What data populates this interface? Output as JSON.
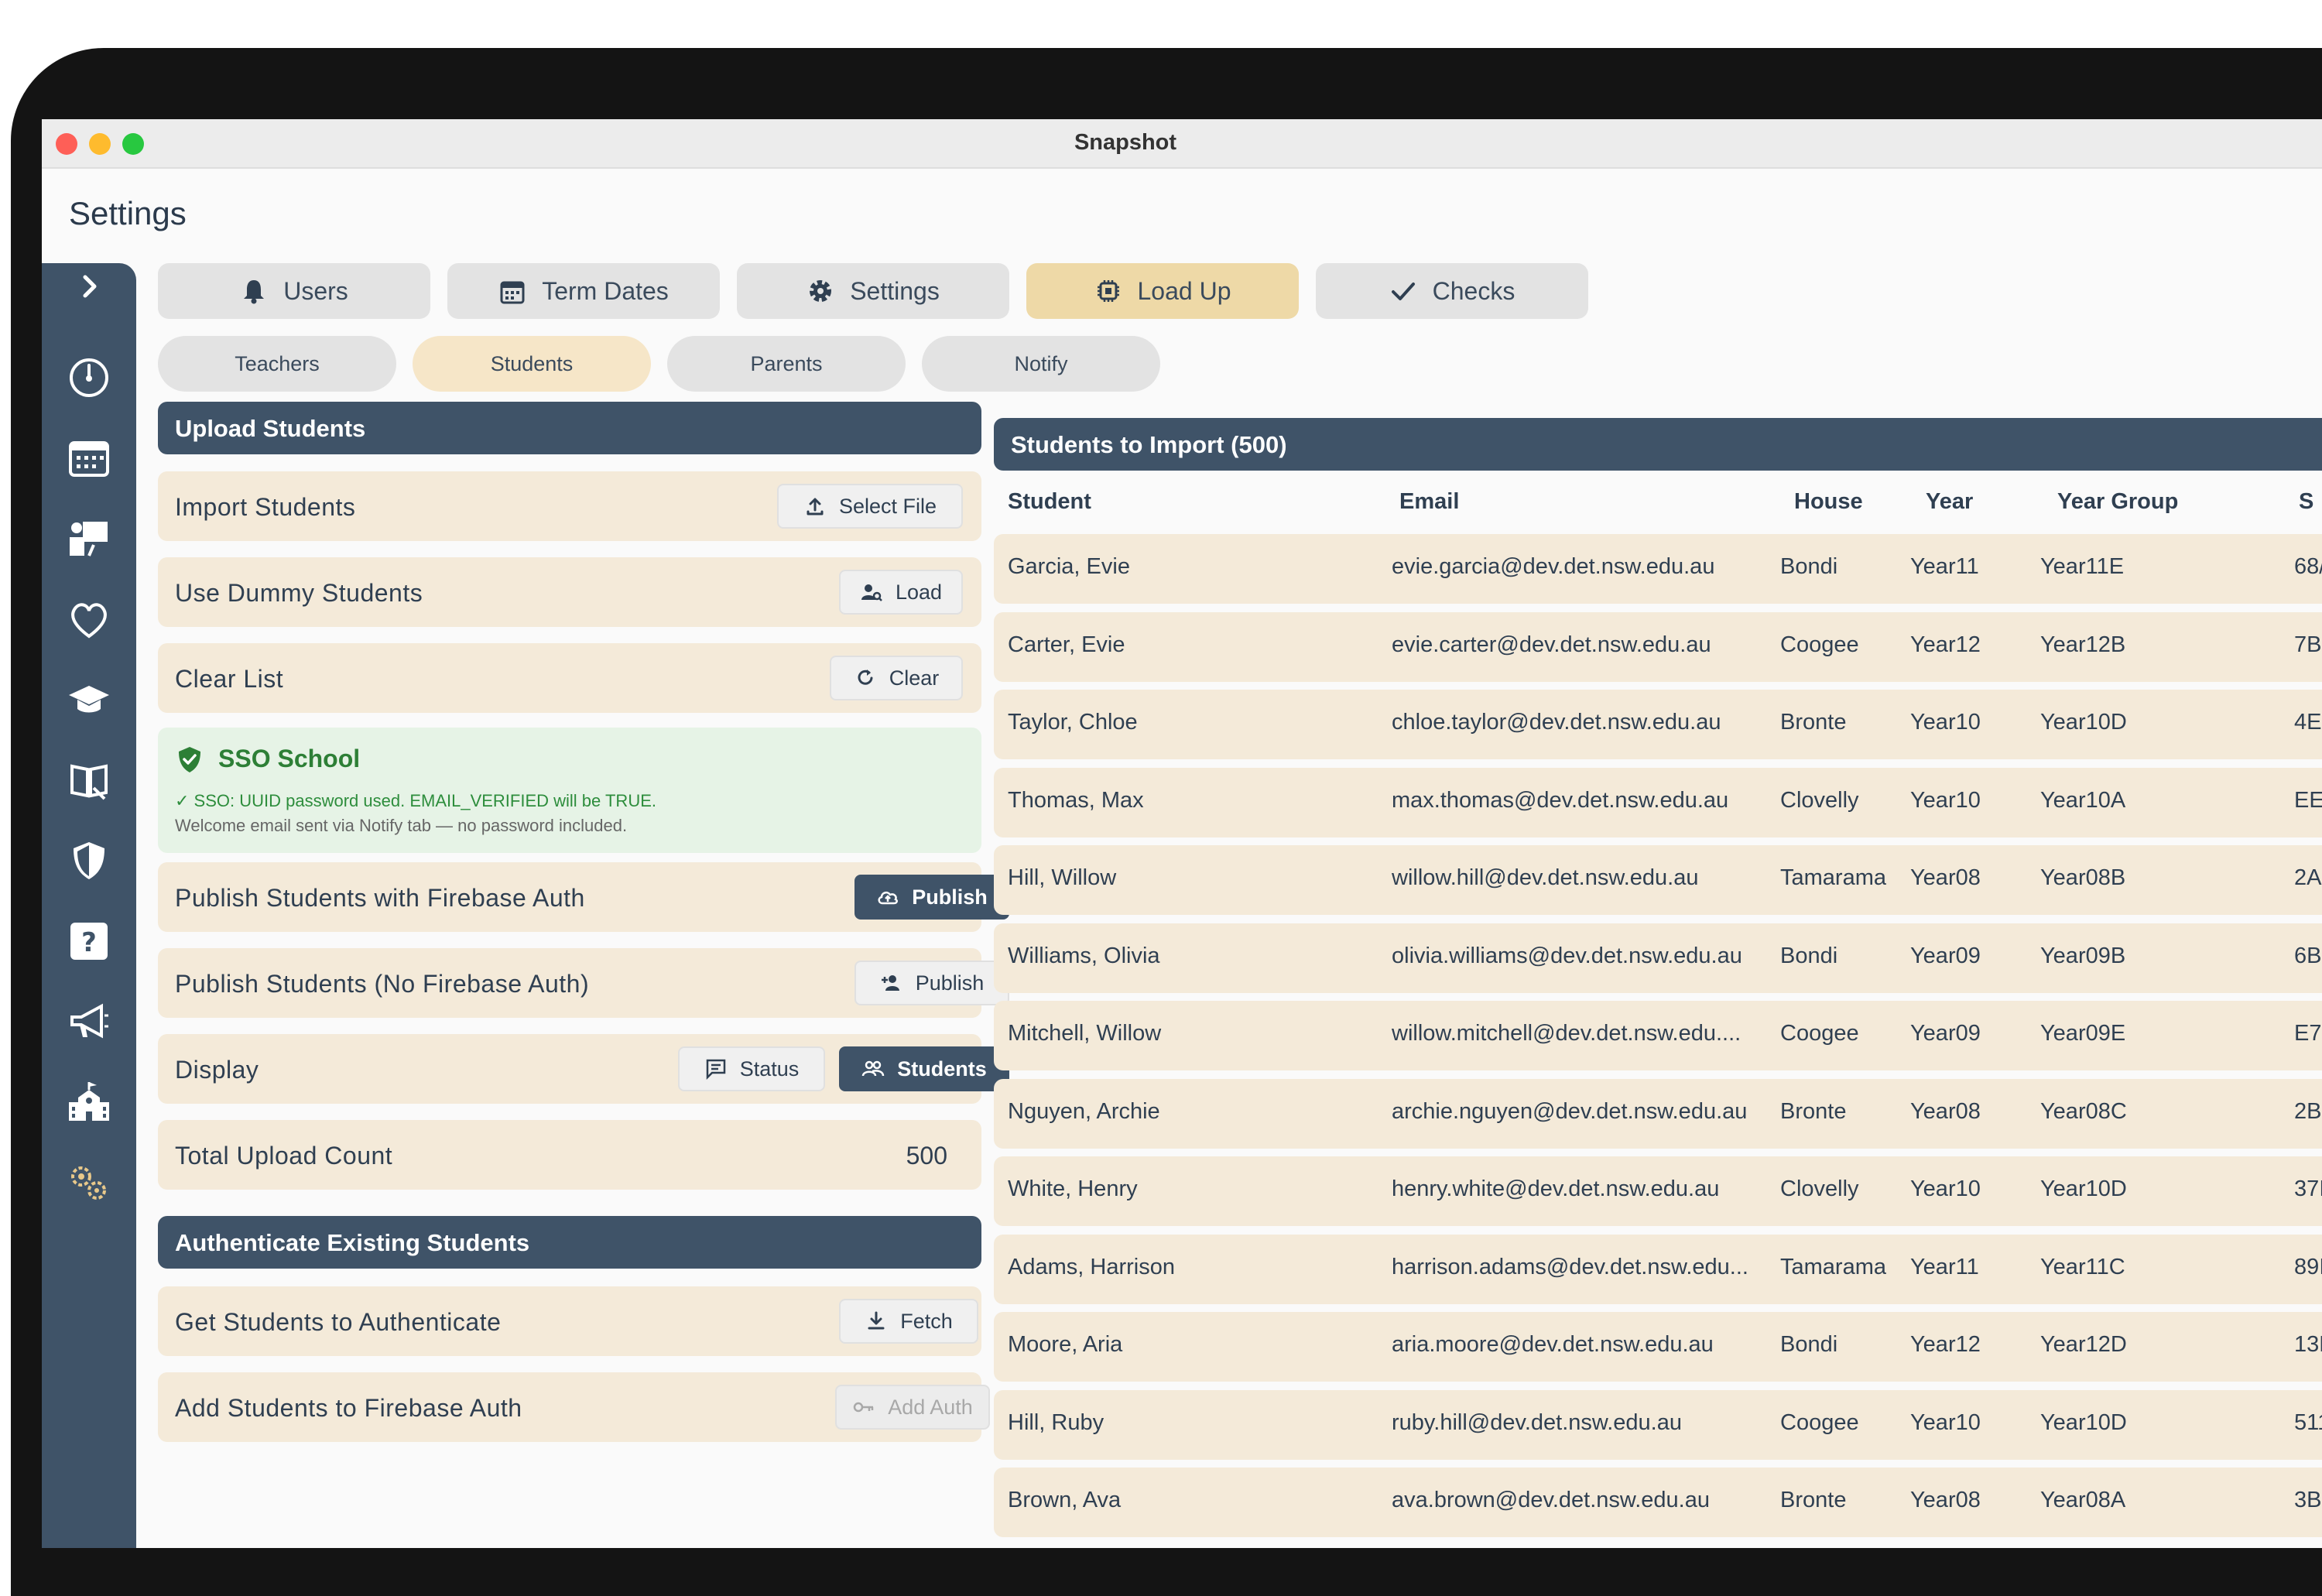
{
  "window": {
    "title": "Snapshot"
  },
  "page": {
    "title": "Settings"
  },
  "sidebar": {
    "items": [
      "chevron-right-icon",
      "dashboard-icon",
      "calendar-icon",
      "teacher-icon",
      "heart-icon",
      "graduation-cap-icon",
      "book-icon",
      "shield-icon",
      "help-icon",
      "megaphone-icon",
      "school-icon",
      "gears-icon"
    ]
  },
  "tabs": [
    {
      "label": "Users",
      "icon": "bell-icon"
    },
    {
      "label": "Term Dates",
      "icon": "calendar-icon"
    },
    {
      "label": "Settings",
      "icon": "gear-icon"
    },
    {
      "label": "Load Up",
      "icon": "chip-icon",
      "active": true
    },
    {
      "label": "Checks",
      "icon": "check-icon"
    }
  ],
  "subtabs": [
    {
      "label": "Teachers"
    },
    {
      "label": "Students",
      "active": true
    },
    {
      "label": "Parents"
    },
    {
      "label": "Notify"
    }
  ],
  "upload": {
    "header": "Upload Students",
    "import_label": "Import Students",
    "import_btn": "Select File",
    "dummy_label": "Use Dummy Students",
    "dummy_btn": "Load",
    "clear_label": "Clear List",
    "clear_btn": "Clear",
    "sso_title": "SSO School",
    "sso_line1": "✓ SSO: UUID password used. EMAIL_VERIFIED will be TRUE.",
    "sso_line2": "Welcome email sent via Notify tab — no password included.",
    "publish_auth_label": "Publish Students with Firebase Auth",
    "publish_auth_btn": "Publish",
    "publish_noauth_label": "Publish Students (No Firebase Auth)",
    "publish_noauth_btn": "Publish",
    "display_label": "Display",
    "display_status_btn": "Status",
    "display_students_btn": "Students",
    "total_label": "Total Upload Count",
    "total_value": "500"
  },
  "auth": {
    "header": "Authenticate Existing Students",
    "get_label": "Get Students to Authenticate",
    "get_btn": "Fetch",
    "add_label": "Add Students to Firebase Auth",
    "add_btn": "Add Auth"
  },
  "table": {
    "header": "Students to Import (500)",
    "columns": [
      "Student",
      "Email",
      "House",
      "Year",
      "Year Group",
      "S"
    ],
    "rows": [
      {
        "student": "Garcia, Evie",
        "email": "evie.garcia@dev.det.nsw.edu.au",
        "house": "Bondi",
        "year": "Year11",
        "group": "Year11E",
        "extra": "68/"
      },
      {
        "student": "Carter, Evie",
        "email": "evie.carter@dev.det.nsw.edu.au",
        "house": "Coogee",
        "year": "Year12",
        "group": "Year12B",
        "extra": "7BI"
      },
      {
        "student": "Taylor, Chloe",
        "email": "chloe.taylor@dev.det.nsw.edu.au",
        "house": "Bronte",
        "year": "Year10",
        "group": "Year10D",
        "extra": "4E7"
      },
      {
        "student": "Thomas, Max",
        "email": "max.thomas@dev.det.nsw.edu.au",
        "house": "Clovelly",
        "year": "Year10",
        "group": "Year10A",
        "extra": "EEI"
      },
      {
        "student": "Hill, Willow",
        "email": "willow.hill@dev.det.nsw.edu.au",
        "house": "Tamarama",
        "year": "Year08",
        "group": "Year08B",
        "extra": "2A!"
      },
      {
        "student": "Williams, Olivia",
        "email": "olivia.williams@dev.det.nsw.edu.au",
        "house": "Bondi",
        "year": "Year09",
        "group": "Year09B",
        "extra": "6B!"
      },
      {
        "student": "Mitchell, Willow",
        "email": "willow.mitchell@dev.det.nsw.edu....",
        "house": "Coogee",
        "year": "Year09",
        "group": "Year09E",
        "extra": "E7!"
      },
      {
        "student": "Nguyen, Archie",
        "email": "archie.nguyen@dev.det.nsw.edu.au",
        "house": "Bronte",
        "year": "Year08",
        "group": "Year08C",
        "extra": "2B("
      },
      {
        "student": "White, Henry",
        "email": "henry.white@dev.det.nsw.edu.au",
        "house": "Clovelly",
        "year": "Year10",
        "group": "Year10D",
        "extra": "37I"
      },
      {
        "student": "Adams, Harrison",
        "email": "harrison.adams@dev.det.nsw.edu...",
        "house": "Tamarama",
        "year": "Year11",
        "group": "Year11C",
        "extra": "89I"
      },
      {
        "student": "Moore, Aria",
        "email": "aria.moore@dev.det.nsw.edu.au",
        "house": "Bondi",
        "year": "Year12",
        "group": "Year12D",
        "extra": "13D"
      },
      {
        "student": "Hill, Ruby",
        "email": "ruby.hill@dev.det.nsw.edu.au",
        "house": "Coogee",
        "year": "Year10",
        "group": "Year10D",
        "extra": "511"
      },
      {
        "student": "Brown, Ava",
        "email": "ava.brown@dev.det.nsw.edu.au",
        "house": "Bronte",
        "year": "Year08",
        "group": "Year08A",
        "extra": "3B1"
      }
    ]
  },
  "colors": {
    "navy": "#3f5368",
    "accent": "#eed9a7",
    "row": "#f4ead9",
    "success": "#2d7f36"
  }
}
